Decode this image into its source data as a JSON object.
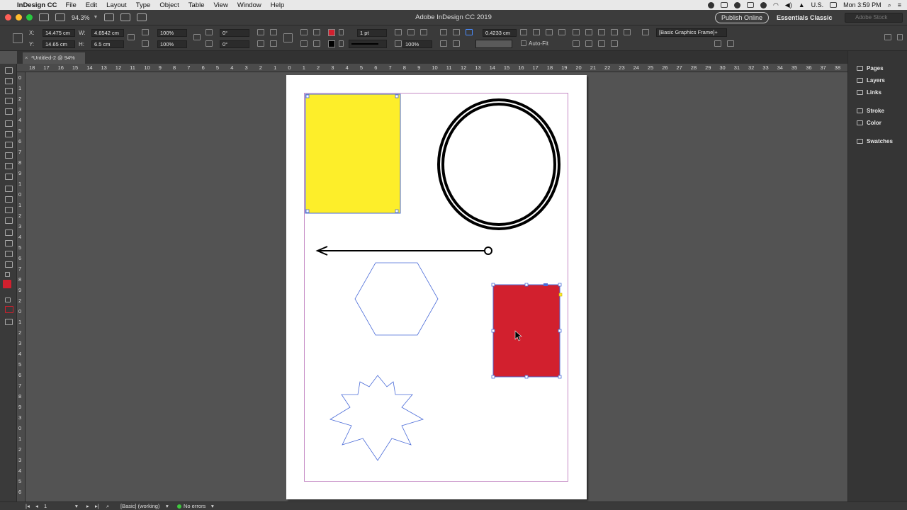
{
  "menubar": {
    "app_name": "InDesign CC",
    "items": [
      "File",
      "Edit",
      "Layout",
      "Type",
      "Object",
      "Table",
      "View",
      "Window",
      "Help"
    ],
    "language": "U.S.",
    "clock": "Mon 3:59 PM"
  },
  "appbar": {
    "zoom": "94.3%",
    "title": "Adobe InDesign CC 2019",
    "publish_label": "Publish Online",
    "workspace": "Essentials Classic",
    "stock_placeholder": "Adobe Stock"
  },
  "control": {
    "x_label": "X:",
    "x_value": "14.475 cm",
    "y_label": "Y:",
    "y_value": "14.65 cm",
    "w_label": "W:",
    "w_value": "4.6542 cm",
    "h_label": "H:",
    "h_value": "6.5 cm",
    "scale_x": "100%",
    "scale_y": "100%",
    "rotate": "0°",
    "shear": "0°",
    "stroke_weight": "1 pt",
    "offset": "0.4233 cm",
    "opacity": "100%",
    "auto_fit": "Auto-Fit",
    "style": "[Basic Graphics Frame]+"
  },
  "doc_tab": {
    "name": "*Untitled-2 @ 94%"
  },
  "ruler": {
    "h_ticks": [
      "18",
      "17",
      "16",
      "15",
      "14",
      "13",
      "12",
      "11",
      "10",
      "9",
      "8",
      "7",
      "6",
      "5",
      "4",
      "3",
      "2",
      "1",
      "0",
      "1",
      "2",
      "3",
      "4",
      "5",
      "6",
      "7",
      "8",
      "9",
      "10",
      "11",
      "12",
      "13",
      "14",
      "15",
      "16",
      "17",
      "18",
      "19",
      "20",
      "21",
      "22",
      "23",
      "24",
      "25",
      "26",
      "27",
      "28",
      "29",
      "30",
      "31",
      "32",
      "33",
      "34",
      "35",
      "36",
      "37",
      "38"
    ],
    "v_ticks": [
      "0",
      "1",
      "2",
      "3",
      "4",
      "5",
      "6",
      "7",
      "8",
      "9",
      "1",
      "0",
      "1",
      "2",
      "3",
      "4",
      "5",
      "6",
      "7",
      "8",
      "9",
      "2",
      "0",
      "1",
      "2",
      "3",
      "4",
      "5",
      "6",
      "7",
      "8",
      "9",
      "3",
      "0",
      "1",
      "2",
      "3",
      "4",
      "5",
      "6"
    ]
  },
  "panels": [
    "Pages",
    "Layers",
    "Links",
    "Stroke",
    "Color",
    "Swatches"
  ],
  "status": {
    "page_number": "1",
    "style": "[Basic] (working)",
    "preflight": "No errors"
  },
  "colors": {
    "yellow_fill": "#fdee2a",
    "red_fill": "#d2202e",
    "selection": "#4a6bd8",
    "margin": "#c58ac5"
  }
}
